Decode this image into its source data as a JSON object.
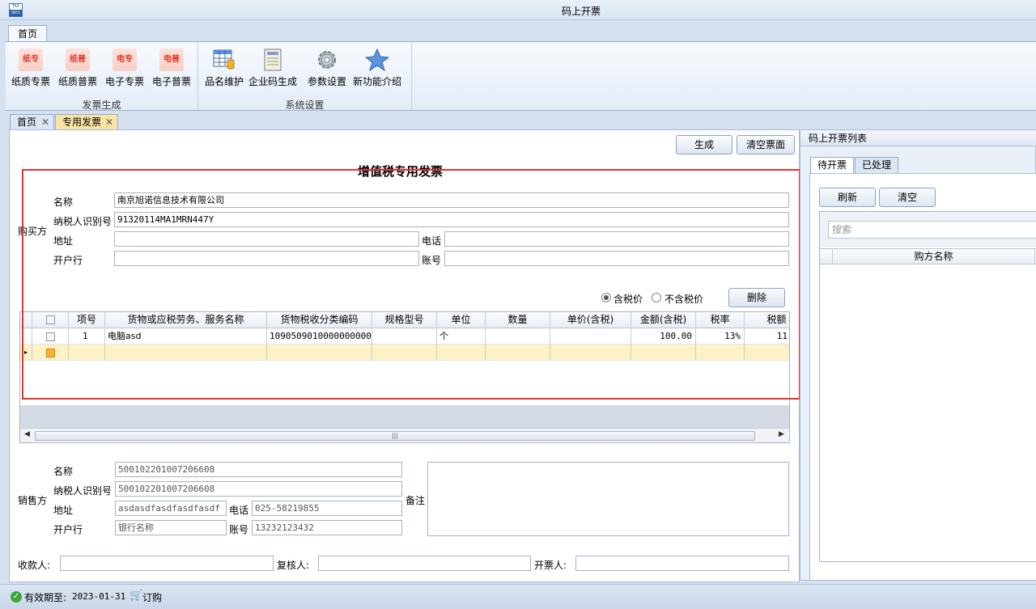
{
  "window": {
    "title": "码上开票",
    "app_icon_top": "TAX",
    "app_icon_bottom": "NO1"
  },
  "ribbon": {
    "tab": "首页",
    "groups": [
      {
        "label": "发票生成",
        "buttons": [
          {
            "label": "纸质专票",
            "icon_text": "纸专",
            "icon": "paper-special-invoice-icon"
          },
          {
            "label": "纸质普票",
            "icon_text": "纸普",
            "icon": "paper-normal-invoice-icon"
          },
          {
            "label": "电子专票",
            "icon_text": "电专",
            "icon": "e-special-invoice-icon"
          },
          {
            "label": "电子普票",
            "icon_text": "电普",
            "icon": "e-normal-invoice-icon"
          }
        ]
      },
      {
        "label": "系统设置",
        "buttons": [
          {
            "label": "品名维护",
            "icon": "product-table-icon"
          },
          {
            "label": "企业码生成",
            "icon": "enterprise-code-icon"
          },
          {
            "label": "参数设置",
            "icon": "gear-icon"
          },
          {
            "label": "新功能介绍",
            "icon": "star-icon"
          }
        ]
      }
    ]
  },
  "doc_tabs": [
    {
      "label": "首页",
      "active": false
    },
    {
      "label": "专用发票",
      "active": true
    }
  ],
  "form": {
    "title": "增值税专用发票",
    "generate_button": "生成",
    "clear_button": "清空票面",
    "buyer": {
      "section_label": "购买方",
      "name_label": "名称",
      "name_value": "南京旭诺信息技术有限公司",
      "tax_id_label": "纳税人识别号",
      "tax_id_value": "91320114MA1MRN447Y",
      "address_label": "地址",
      "address_value": "",
      "phone_label": "电话",
      "phone_value": "",
      "bank_label": "开户行",
      "bank_value": "",
      "account_label": "账号",
      "account_value": ""
    },
    "price_mode": {
      "tax_included": "含税价",
      "tax_excluded": "不含税价",
      "selected": "tax_included"
    },
    "delete_button": "删除",
    "grid": {
      "columns": [
        "",
        "项号",
        "货物或应税劳务、服务名称",
        "货物税收分类编码",
        "规格型号",
        "单位",
        "数量",
        "单价(含税)",
        "金额(含税)",
        "税率",
        "税额"
      ],
      "rows": [
        {
          "no": "1",
          "name": "电脑asd",
          "code": "1090509010000000000",
          "spec": "",
          "unit": "个",
          "qty": "",
          "price": "",
          "amount": "100.00",
          "rate": "13%",
          "tax": "11"
        }
      ]
    },
    "seller": {
      "section_label": "销售方",
      "name_label": "名称",
      "name_value": "500102201007206608",
      "tax_id_label": "纳税人识别号",
      "tax_id_value": "500102201007206608",
      "address_label": "地址",
      "address_value": "asdasdfasdfasdfasdf",
      "phone_label": "电话",
      "phone_value": "025-58219855",
      "bank_label": "开户行",
      "bank_value": "银行名称",
      "account_label": "账号",
      "account_value": "13232123432"
    },
    "remark_label": "备注",
    "payee_label": "收款人:",
    "reviewer_label": "复核人:",
    "drawer_label": "开票人:"
  },
  "right_panel": {
    "title": "码上开票列表",
    "tabs": [
      "待开票",
      "已处理"
    ],
    "refresh_button": "刷新",
    "clear_button": "清空",
    "search_placeholder": "搜索",
    "column": "购方名称"
  },
  "status": {
    "expiry_label": "有效期至:",
    "expiry_date": "2023-01-31",
    "order_label": "订购"
  }
}
